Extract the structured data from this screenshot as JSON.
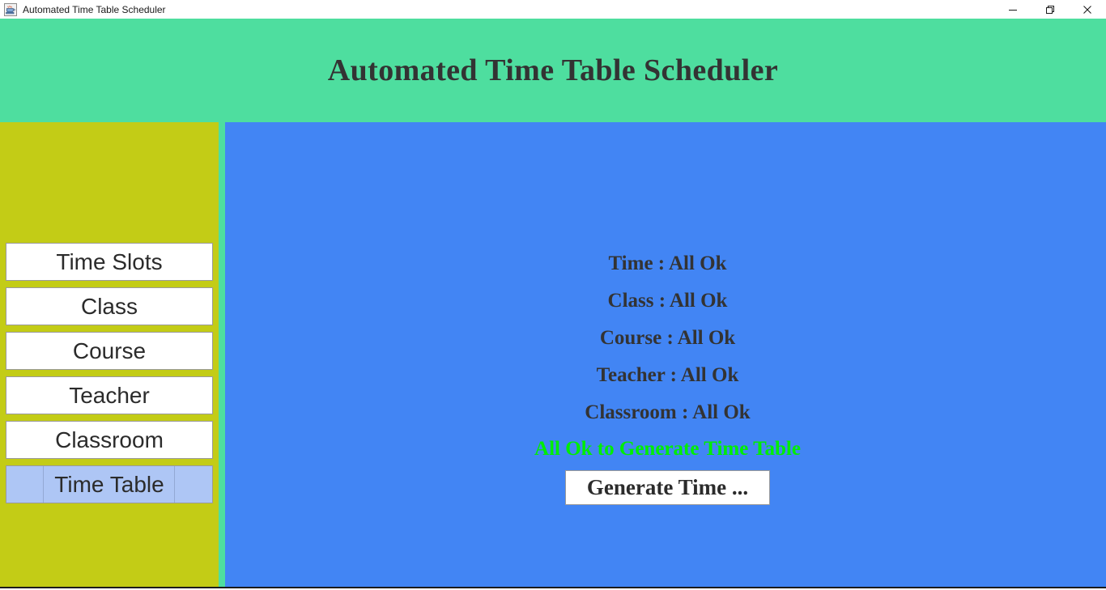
{
  "window": {
    "title": "Automated Time Table Scheduler",
    "icon": "java-coffee-cup-icon",
    "controls": {
      "minimize": "minimize-icon",
      "restore": "restore-icon",
      "close": "close-icon"
    }
  },
  "header": {
    "title": "Automated Time Table Scheduler",
    "background_color": "#4ede9f",
    "text_color": "#333333"
  },
  "sidebar": {
    "background_color": "#c3cc16",
    "items": [
      {
        "label": "Time Slots",
        "selected": false
      },
      {
        "label": "Class",
        "selected": false
      },
      {
        "label": "Course",
        "selected": false
      },
      {
        "label": "Teacher",
        "selected": false
      },
      {
        "label": "Classroom",
        "selected": false
      },
      {
        "label": "Time Table",
        "selected": true
      }
    ],
    "selected_color": "#aec6f5"
  },
  "main": {
    "background_color": "#4285f4",
    "status_lines": [
      {
        "label": "Time : All Ok"
      },
      {
        "label": "Class : All Ok"
      },
      {
        "label": "Course : All Ok"
      },
      {
        "label": "Teacher : All Ok"
      },
      {
        "label": "Classroom : All Ok"
      }
    ],
    "ready_message": "All Ok to Generate Time Table",
    "ready_color": "#00ee00",
    "generate_button_label": "Generate Time ..."
  }
}
